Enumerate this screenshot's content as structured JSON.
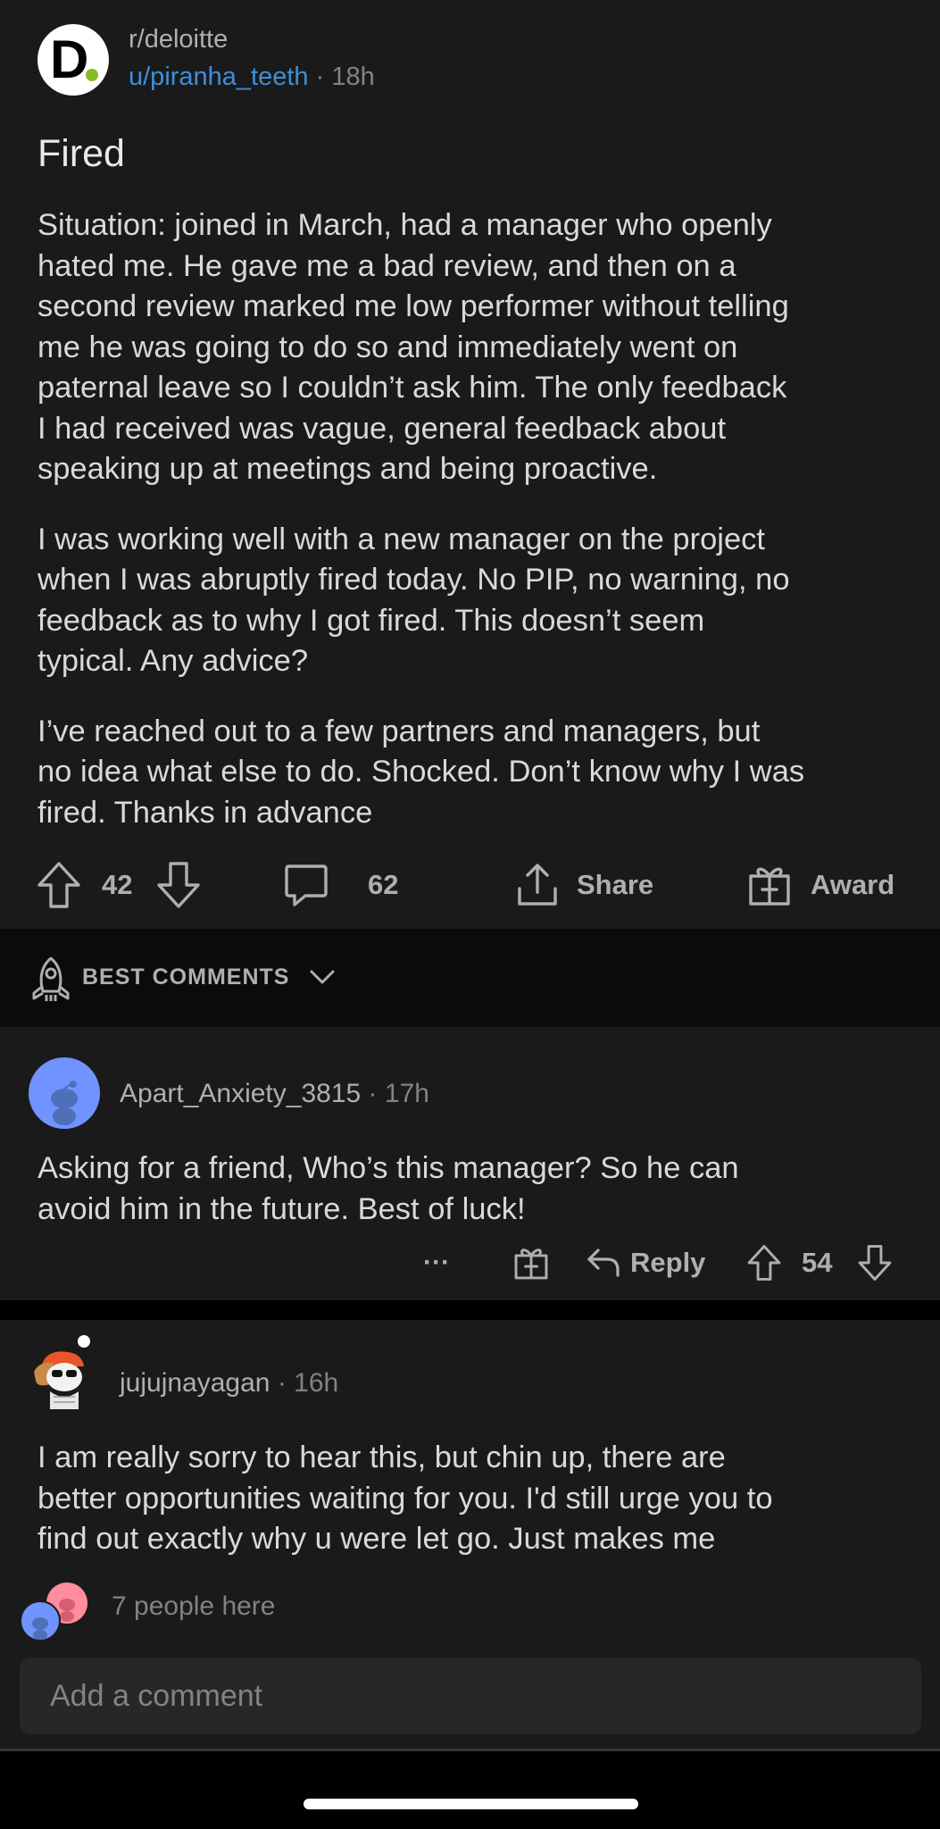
{
  "post": {
    "subreddit": "r/deloitte",
    "author": "u/piranha_teeth",
    "separator": "·",
    "time": "18h",
    "title": "Fired",
    "paragraphs": [
      "Situation: joined in March, had a manager who openly\nhated me. He gave me a bad review, and then on a\nsecond review marked me low performer without telling\nme he was going to do so and immediately went on\npaternal leave so I couldn’t ask him. The only feedback\nI had received was vague, general feedback about\nspeaking up at meetings and being proactive.",
      "I was working well with a new manager on the project\nwhen I was abruptly fired today. No PIP, no warning, no\nfeedback as to why I got fired. This doesn’t seem\ntypical. Any advice?",
      "I’ve reached out to a few partners and managers, but\nno idea what else to do. Shocked. Don’t know why I was\nfired. Thanks in advance"
    ],
    "votes": "42",
    "comments": "62",
    "share_label": "Share",
    "award_label": "Award",
    "sub_logo_letter": "D",
    "brand_dot_color": "#86bc25"
  },
  "sort": {
    "label": "BEST COMMENTS"
  },
  "comments": [
    {
      "author": "Apart_Anxiety_3815",
      "time": "17h",
      "body": "Asking for a friend, Who’s this manager? So he can\navoid him in the future. Best of luck!",
      "more": "···",
      "reply_label": "Reply",
      "votes": "54"
    },
    {
      "author": "jujujnayagan",
      "time": "16h",
      "body": "I am really sorry to hear this, but chin up, there are\nbetter opportunities waiting for you. I'd still urge you to\nfind out exactly why u were let go. Just makes me"
    }
  ],
  "presence": {
    "text": "7 people here"
  },
  "composer": {
    "placeholder": "Add a comment"
  },
  "icons": {
    "upvote": "arrow-up-icon",
    "downvote": "arrow-down-icon",
    "comment": "speech-bubble-icon",
    "share": "share-icon",
    "award": "gift-icon",
    "sort": "rocket-icon",
    "chevron": "chevron-down-icon"
  }
}
